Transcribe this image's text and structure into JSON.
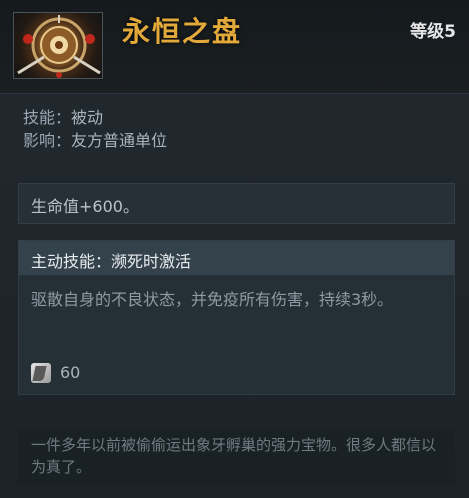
{
  "item": {
    "name": "永恒之盘",
    "level_label": "等级5",
    "icon": "aeon-disk-icon"
  },
  "meta": {
    "ability_label": "技能：",
    "ability_value": "被动",
    "affects_label": "影响：",
    "affects_value": "友方普通单位"
  },
  "bonus": {
    "text": "生命值+600。"
  },
  "active_ability": {
    "title": "主动技能：濒死时激活",
    "description": "驱散自身的不良状态，并免疫所有伤害，持续3秒。",
    "cooldown_icon": "cooldown-icon",
    "cooldown_value": "60"
  },
  "lore": {
    "text": "一件多年以前被偷偷运出象牙孵巢的强力宝物。很多人都信以为真了。"
  },
  "colors": {
    "title_gold": "#e3a93a",
    "background": "#1f262b"
  }
}
